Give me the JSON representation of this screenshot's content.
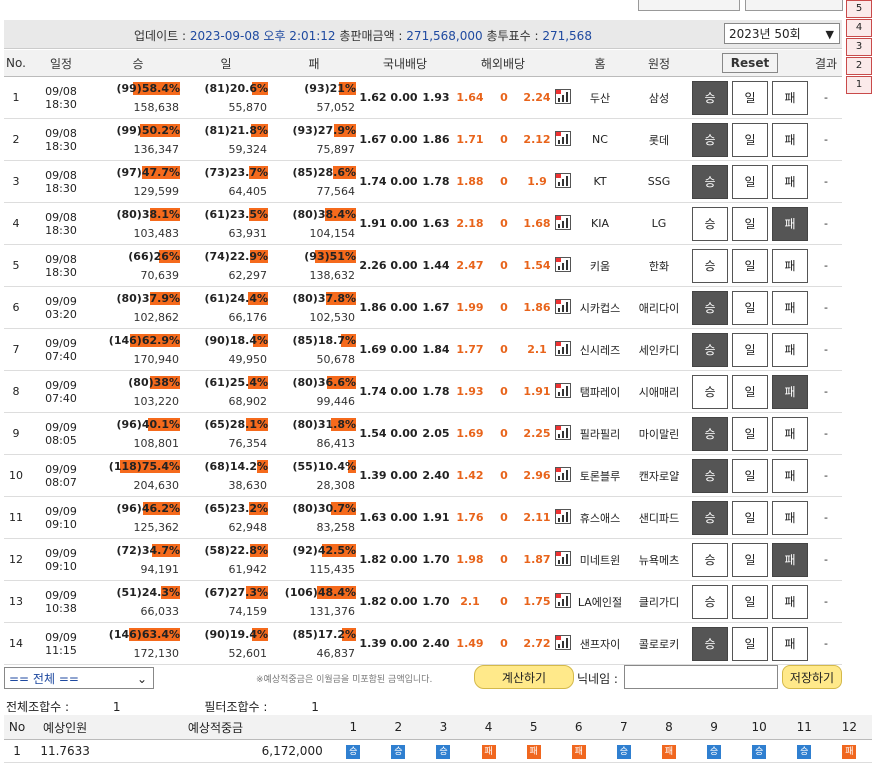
{
  "update_bar": {
    "label": "업데이트 :",
    "updated_at": "2023-09-08 오후 2:01:12",
    "sales_label": "총판매금액 :",
    "sales_total": "271,568,000",
    "votes_label": "총투표수 :",
    "votes_total": "271,568",
    "round_selected": "2023년 50회"
  },
  "side_tabs": [
    "5",
    "4",
    "3",
    "2",
    "1"
  ],
  "headers": {
    "no": "No.",
    "schedule": "일정",
    "win": "승",
    "draw": "일",
    "lose": "패",
    "domestic": "국내배당",
    "overseas": "해외배당",
    "home": "홈",
    "away": "원정",
    "reset": "Reset",
    "result": "결과"
  },
  "pick_labels": {
    "win": "승",
    "draw": "일",
    "lose": "패"
  },
  "matches": [
    {
      "no": "1",
      "date": "09/08 18:30",
      "win": {
        "cnt": "(99)",
        "pct": "58.4%",
        "amt": "158,638"
      },
      "draw": {
        "cnt": "(81)",
        "pct": "20.6%",
        "amt": "55,870"
      },
      "lose": {
        "cnt": "(93)",
        "pct": "21%",
        "amt": "57,052"
      },
      "dom": [
        "1.62",
        "0.00",
        "1.93"
      ],
      "ovs": [
        "1.64",
        "0",
        "2.24"
      ],
      "home": "두산",
      "away": "삼성",
      "selected": "win",
      "result": "-"
    },
    {
      "no": "2",
      "date": "09/08 18:30",
      "win": {
        "cnt": "(99)",
        "pct": "50.2%",
        "amt": "136,347"
      },
      "draw": {
        "cnt": "(81)",
        "pct": "21.8%",
        "amt": "59,324"
      },
      "lose": {
        "cnt": "(93)",
        "pct": "27.9%",
        "amt": "75,897"
      },
      "dom": [
        "1.67",
        "0.00",
        "1.86"
      ],
      "ovs": [
        "1.71",
        "0",
        "2.12"
      ],
      "home": "NC",
      "away": "롯데",
      "selected": "win",
      "result": "-"
    },
    {
      "no": "3",
      "date": "09/08 18:30",
      "win": {
        "cnt": "(97)",
        "pct": "47.7%",
        "amt": "129,599"
      },
      "draw": {
        "cnt": "(73)",
        "pct": "23.7%",
        "amt": "64,405"
      },
      "lose": {
        "cnt": "(85)",
        "pct": "28.6%",
        "amt": "77,564"
      },
      "dom": [
        "1.74",
        "0.00",
        "1.78"
      ],
      "ovs": [
        "1.88",
        "0",
        "1.9"
      ],
      "home": "KT",
      "away": "SSG",
      "selected": "win",
      "result": "-"
    },
    {
      "no": "4",
      "date": "09/08 18:30",
      "win": {
        "cnt": "(80)",
        "pct": "38.1%",
        "amt": "103,483"
      },
      "draw": {
        "cnt": "(61)",
        "pct": "23.5%",
        "amt": "63,931"
      },
      "lose": {
        "cnt": "(80)",
        "pct": "38.4%",
        "amt": "104,154"
      },
      "dom": [
        "1.91",
        "0.00",
        "1.63"
      ],
      "ovs": [
        "2.18",
        "0",
        "1.68"
      ],
      "home": "KIA",
      "away": "LG",
      "selected": "lose",
      "result": "-"
    },
    {
      "no": "5",
      "date": "09/08 18:30",
      "win": {
        "cnt": "(66)",
        "pct": "26%",
        "amt": "70,639"
      },
      "draw": {
        "cnt": "(74)",
        "pct": "22.9%",
        "amt": "62,297"
      },
      "lose": {
        "cnt": "(93)",
        "pct": "51%",
        "amt": "138,632"
      },
      "dom": [
        "2.26",
        "0.00",
        "1.44"
      ],
      "ovs": [
        "2.47",
        "0",
        "1.54"
      ],
      "home": "키움",
      "away": "한화",
      "selected": "none",
      "result": "-"
    },
    {
      "no": "6",
      "date": "09/09 03:20",
      "win": {
        "cnt": "(80)",
        "pct": "37.9%",
        "amt": "102,862"
      },
      "draw": {
        "cnt": "(61)",
        "pct": "24.4%",
        "amt": "66,176"
      },
      "lose": {
        "cnt": "(80)",
        "pct": "37.8%",
        "amt": "102,530"
      },
      "dom": [
        "1.86",
        "0.00",
        "1.67"
      ],
      "ovs": [
        "1.99",
        "0",
        "1.86"
      ],
      "home": "시카컵스",
      "away": "애리다이",
      "selected": "win",
      "result": "-"
    },
    {
      "no": "7",
      "date": "09/09 07:40",
      "win": {
        "cnt": "(146)",
        "pct": "62.9%",
        "amt": "170,940"
      },
      "draw": {
        "cnt": "(90)",
        "pct": "18.4%",
        "amt": "49,950"
      },
      "lose": {
        "cnt": "(85)",
        "pct": "18.7%",
        "amt": "50,678"
      },
      "dom": [
        "1.69",
        "0.00",
        "1.84"
      ],
      "ovs": [
        "1.77",
        "0",
        "2.1"
      ],
      "home": "신시레즈",
      "away": "세인카디",
      "selected": "win",
      "result": "-"
    },
    {
      "no": "8",
      "date": "09/09 07:40",
      "win": {
        "cnt": "(80)",
        "pct": "38%",
        "amt": "103,220"
      },
      "draw": {
        "cnt": "(61)",
        "pct": "25.4%",
        "amt": "68,902"
      },
      "lose": {
        "cnt": "(80)",
        "pct": "36.6%",
        "amt": "99,446"
      },
      "dom": [
        "1.74",
        "0.00",
        "1.78"
      ],
      "ovs": [
        "1.93",
        "0",
        "1.91"
      ],
      "home": "탬파레이",
      "away": "시애매리",
      "selected": "lose",
      "result": "-"
    },
    {
      "no": "9",
      "date": "09/09 08:05",
      "win": {
        "cnt": "(96)",
        "pct": "40.1%",
        "amt": "108,801"
      },
      "draw": {
        "cnt": "(65)",
        "pct": "28.1%",
        "amt": "76,354"
      },
      "lose": {
        "cnt": "(80)",
        "pct": "31.8%",
        "amt": "86,413"
      },
      "dom": [
        "1.54",
        "0.00",
        "2.05"
      ],
      "ovs": [
        "1.69",
        "0",
        "2.25"
      ],
      "home": "필라필리",
      "away": "마이말린",
      "selected": "win",
      "result": "-"
    },
    {
      "no": "10",
      "date": "09/09 08:07",
      "win": {
        "cnt": "(118)",
        "pct": "75.4%",
        "amt": "204,630"
      },
      "draw": {
        "cnt": "(68)",
        "pct": "14.2%",
        "amt": "38,630"
      },
      "lose": {
        "cnt": "(55)",
        "pct": "10.4%",
        "amt": "28,308"
      },
      "dom": [
        "1.39",
        "0.00",
        "2.40"
      ],
      "ovs": [
        "1.42",
        "0",
        "2.96"
      ],
      "home": "토론블루",
      "away": "캔자로얄",
      "selected": "win",
      "result": "-"
    },
    {
      "no": "11",
      "date": "09/09 09:10",
      "win": {
        "cnt": "(96)",
        "pct": "46.2%",
        "amt": "125,362"
      },
      "draw": {
        "cnt": "(65)",
        "pct": "23.2%",
        "amt": "62,948"
      },
      "lose": {
        "cnt": "(80)",
        "pct": "30.7%",
        "amt": "83,258"
      },
      "dom": [
        "1.63",
        "0.00",
        "1.91"
      ],
      "ovs": [
        "1.76",
        "0",
        "2.11"
      ],
      "home": "휴스애스",
      "away": "샌디파드",
      "selected": "win",
      "result": "-"
    },
    {
      "no": "12",
      "date": "09/09 09:10",
      "win": {
        "cnt": "(72)",
        "pct": "34.7%",
        "amt": "94,191"
      },
      "draw": {
        "cnt": "(58)",
        "pct": "22.8%",
        "amt": "61,942"
      },
      "lose": {
        "cnt": "(92)",
        "pct": "42.5%",
        "amt": "115,435"
      },
      "dom": [
        "1.82",
        "0.00",
        "1.70"
      ],
      "ovs": [
        "1.98",
        "0",
        "1.87"
      ],
      "home": "미네트윈",
      "away": "뉴욕메츠",
      "selected": "lose",
      "result": "-"
    },
    {
      "no": "13",
      "date": "09/09 10:38",
      "win": {
        "cnt": "(51)",
        "pct": "24.3%",
        "amt": "66,033"
      },
      "draw": {
        "cnt": "(67)",
        "pct": "27.3%",
        "amt": "74,159"
      },
      "lose": {
        "cnt": "(106)",
        "pct": "48.4%",
        "amt": "131,376"
      },
      "dom": [
        "1.82",
        "0.00",
        "1.70"
      ],
      "ovs": [
        "2.1",
        "0",
        "1.75"
      ],
      "home": "LA에인절",
      "away": "클리가디",
      "selected": "none",
      "result": "-"
    },
    {
      "no": "14",
      "date": "09/09 11:15",
      "win": {
        "cnt": "(146)",
        "pct": "63.4%",
        "amt": "172,130"
      },
      "draw": {
        "cnt": "(90)",
        "pct": "19.4%",
        "amt": "52,601"
      },
      "lose": {
        "cnt": "(85)",
        "pct": "17.2%",
        "amt": "46,837"
      },
      "dom": [
        "1.39",
        "0.00",
        "2.40"
      ],
      "ovs": [
        "1.49",
        "0",
        "2.72"
      ],
      "home": "샌프자이",
      "away": "콜로로키",
      "selected": "win",
      "result": "-"
    }
  ],
  "controls": {
    "filter_selected": "== 전체 ==",
    "note": "※예상적중금은 이월금을 미포함된 금액입니다.",
    "calc_button": "계산하기",
    "nickname_label": "닉네임 :",
    "nickname_value": "",
    "save_button": "저장하기"
  },
  "counts": {
    "total_label": "전체조합수 :",
    "total": "1",
    "filter_label": "필터조합수 :",
    "filter": "1"
  },
  "result_table": {
    "headers": {
      "no": "No",
      "people": "예상인원",
      "prize": "예상적중금"
    },
    "game_numbers": [
      "1",
      "2",
      "3",
      "4",
      "5",
      "6",
      "7",
      "8",
      "9",
      "10",
      "11",
      "12"
    ],
    "rows": [
      {
        "no": "1",
        "people": "11.7633",
        "prize": "6,172,000",
        "picks": [
          "승",
          "승",
          "승",
          "패",
          "패",
          "패",
          "승",
          "패",
          "승",
          "승",
          "승",
          "패"
        ]
      }
    ]
  },
  "colors": {
    "accent_orange": "#f56a1c",
    "selected_dark": "#555555",
    "link_blue": "#1f4aa0",
    "win_badge": "#2f7fd0",
    "lose_badge": "#f0671f"
  }
}
